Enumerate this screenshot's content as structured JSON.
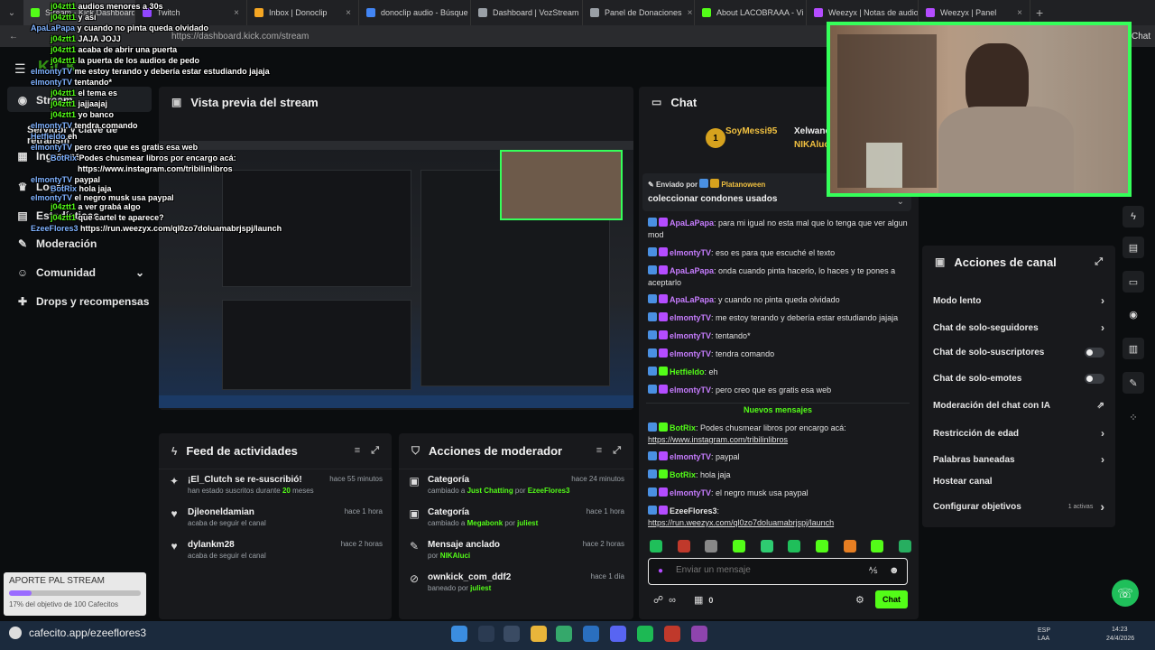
{
  "browser": {
    "tabs": [
      {
        "label": "Stream - Kick Dashboard",
        "color": "#53fc18"
      },
      {
        "label": "Twitch",
        "color": "#9146ff"
      },
      {
        "label": "Inbox | Donoclip",
        "color": "#f5a623"
      },
      {
        "label": "donoclip audio - Búsque",
        "color": "#4285f4"
      },
      {
        "label": "Dashboard | VozStream",
        "color": "#9aa0a6"
      },
      {
        "label": "Panel de Donaciones",
        "color": "#9aa0a6"
      },
      {
        "label": "About LACOBRAAA - Vi",
        "color": "#53fc18"
      },
      {
        "label": "Weezyx | Notas de audio",
        "color": "#b44cff"
      },
      {
        "label": "Weezyx | Panel",
        "color": "#b44cff"
      }
    ],
    "url": "https://dashboard.kick.com/stream",
    "chat_shortcut": "Chat"
  },
  "sidebar": {
    "stream": "Stream",
    "key": "Servidor y clave de retransm",
    "ingresos": "Ingresos",
    "logros": "Logros",
    "estadisticas": "Estadísticas",
    "moderacion": "Moderación",
    "comunidad": "Comunidad",
    "drops": "Drops y recompensas"
  },
  "preview": {
    "title": "Vista previa del stream"
  },
  "feed": {
    "title": "Feed de actividades",
    "items": [
      {
        "icon": "✦",
        "title": "¡El_Clutch se re-suscribió!",
        "sub_pre": "han estado suscritos durante ",
        "sub_bold": "20",
        "sub_post": " meses",
        "time": "hace 55 minutos"
      },
      {
        "icon": "♥",
        "title": "Djleonelda­mian",
        "sub_pre": "acaba de seguir el canal",
        "sub_bold": "",
        "sub_post": "",
        "time": "hace 1 hora"
      },
      {
        "icon": "♥",
        "title": "dylankm28",
        "sub_pre": "acaba de seguir el canal",
        "sub_bold": "",
        "sub_post": "",
        "time": "hace 2 horas"
      }
    ]
  },
  "modactions": {
    "title": "Acciones de moderador",
    "items": [
      {
        "icon": "▣",
        "title": "Categoría",
        "sub_pre": "cambiado a ",
        "sub_bold": "Just Chatting",
        "sub_mid": " por ",
        "sub_bold2": "EzeeFlores3",
        "time": "hace 24 minutos"
      },
      {
        "icon": "▣",
        "title": "Categoría",
        "sub_pre": "cambiado a ",
        "sub_bold": "Megabonk",
        "sub_mid": " por ",
        "sub_bold2": "juliest",
        "time": "hace 1 hora"
      },
      {
        "icon": "✎",
        "title": "Mensaje anclado",
        "sub_pre": "",
        "sub_bold": "",
        "sub_mid": "por ",
        "sub_bold2": "NIKAluci",
        "time": "hace 2 horas"
      },
      {
        "icon": "⊘",
        "title": "ownkick_com_ddf2",
        "sub_pre": "",
        "sub_bold": "",
        "sub_mid": "baneado por ",
        "sub_bold2": "juliest",
        "time": "hace 1 día"
      }
    ]
  },
  "chat": {
    "title": "Chat",
    "top_users": [
      "SoyMessi95",
      "Xelwane",
      "NIKAluci"
    ],
    "pinned_by_label": "Enviado por",
    "pinned_by": "Platanoween",
    "pinned_text": "coleccionar condones usados",
    "messages": [
      {
        "user": "ApaLaPapa",
        "color": "#c77dff",
        "text": "para mi igual no esta mal que lo tenga que ver algun mod"
      },
      {
        "user": "elmontyTV",
        "color": "#c77dff",
        "text": "eso es para que escuché el texto"
      },
      {
        "user": "ApaLaPapa",
        "color": "#c77dff",
        "text": "onda cuando pinta hacerlo, lo haces y te pones a aceptarlo"
      },
      {
        "user": "ApaLaPapa",
        "color": "#c77dff",
        "text": "y cuando no pinta queda olvidado"
      },
      {
        "user": "elmontyTV",
        "color": "#c77dff",
        "text": "me estoy terando y debería estar estudiando jajaja"
      },
      {
        "user": "elmontyTV",
        "color": "#c77dff",
        "text": "tentando*"
      },
      {
        "user": "elmontyTV",
        "color": "#c77dff",
        "text": "tendra comando"
      },
      {
        "user": "Hetfieldo",
        "color": "#53fc18",
        "text": "eh"
      },
      {
        "user": "elmontyTV",
        "color": "#c77dff",
        "text": "pero creo que es gratis esa web"
      }
    ],
    "new_messages": "Nuevos mensajes",
    "messages2": [
      {
        "user": "BotRix",
        "color": "#53fc18",
        "text": "Podes chusmear libros por encargo acá:",
        "link": "https://www.instagram.com/tribilinlibros"
      },
      {
        "user": "elmontyTV",
        "color": "#c77dff",
        "text": "paypal",
        "link": ""
      },
      {
        "user": "BotRix",
        "color": "#53fc18",
        "text": "hola jaja",
        "link": ""
      },
      {
        "user": "elmontyTV",
        "color": "#c77dff",
        "text": "el negro musk usa paypal",
        "link": ""
      },
      {
        "user": "EzeeFlores3",
        "color": "#e6e6e6",
        "text": "",
        "link": "https://run.weezyx.com/ql0zo7doluamabrjspj/launch"
      }
    ],
    "input_placeholder": "Enviar un mensaje",
    "infinity": "∞",
    "count": "0",
    "send": "Chat"
  },
  "channel_actions": {
    "title": "Acciones de canal",
    "items": [
      {
        "label": "Modo lento",
        "kind": "chev"
      },
      {
        "label": "Chat de solo-seguidores",
        "kind": "chev"
      },
      {
        "label": "Chat de solo-suscriptores",
        "kind": "toggle"
      },
      {
        "label": "Chat de solo-emotes",
        "kind": "toggle"
      },
      {
        "label": "Moderación del chat con IA",
        "kind": "ext"
      },
      {
        "label": "Restricción de edad",
        "kind": "chev"
      },
      {
        "label": "Palabras baneadas",
        "kind": "chev"
      },
      {
        "label": "Hostear canal",
        "kind": "none"
      },
      {
        "label": "Configurar objetivos",
        "kind": "chev"
      }
    ],
    "goals_active": "1 activas"
  },
  "goal_widget": {
    "label": "APORTE PAL STREAM",
    "progress_text": "17% del objetivo de 100 Cafecitos",
    "progress": 0.17
  },
  "overlay_chat": [
    {
      "user": "j04ztt1",
      "text": "audios menores a 30s"
    },
    {
      "user": "j04ztt1",
      "text": "y así"
    },
    {
      "user": "ApaLaPapa",
      "text": "y cuando no pinta queda olvidado"
    },
    {
      "user": "j04ztt1",
      "text": "JAJA JOJJ"
    },
    {
      "user": "j04ztt1",
      "text": "acaba de abrir una puerta"
    },
    {
      "user": "j04ztt1",
      "text": "la puerta de los audios de pedo"
    },
    {
      "user": "elmontyTV",
      "text": "me estoy terando y debería estar estudiando jajaja"
    },
    {
      "user": "elmontyTV",
      "text": "tentando*"
    },
    {
      "user": "j04ztt1",
      "text": "el tema es"
    },
    {
      "user": "j04ztt1",
      "text": "jajjaajaj"
    },
    {
      "user": "j04ztt1",
      "text": "yo banco"
    },
    {
      "user": "elmontyTV",
      "text": "tendra comando"
    },
    {
      "user": "Hetfieldo",
      "text": "eh"
    },
    {
      "user": "elmontyTV",
      "text": "pero creo que es gratis esa web"
    },
    {
      "user": "BotRix",
      "text": "Podes chusmear libros por encargo acá:"
    },
    {
      "user": "",
      "text": "https://www.instagram.com/tribilinlibros"
    },
    {
      "user": "elmontyTV",
      "text": "paypal"
    },
    {
      "user": "BotRix",
      "text": "hola jaja"
    },
    {
      "user": "elmontyTV",
      "text": "el negro musk usa paypal"
    },
    {
      "user": "j04ztt1",
      "text": "a ver grabá algo"
    },
    {
      "user": "j04ztt1",
      "text": "que cartel te aparece?"
    },
    {
      "user": "EzeeFlores3",
      "text": "https://run.weezyx.com/ql0zo7doluamabrjspj/launch"
    }
  ],
  "taskbar": {
    "site": "cafecito.app/ezeeflores3",
    "lang": "ESP\nLAA",
    "time": "14:23",
    "date": "24/4/2026"
  }
}
